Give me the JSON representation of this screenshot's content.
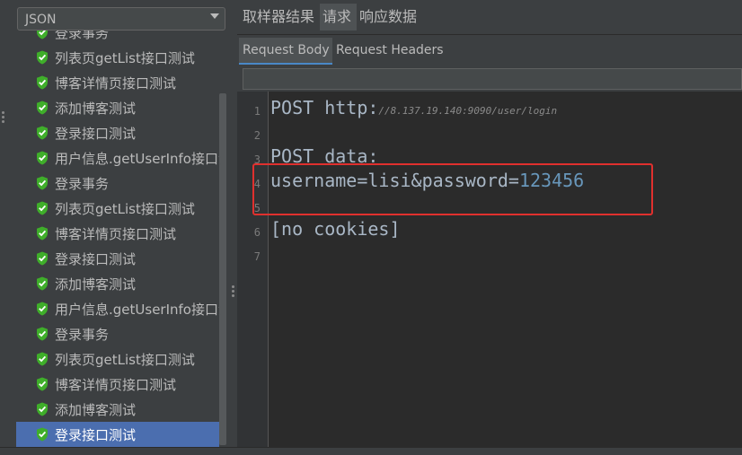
{
  "sampler_selector": {
    "value": "JSON"
  },
  "tree": {
    "items": [
      {
        "label": "登录事务",
        "selected": false
      },
      {
        "label": "列表页getList接口测试",
        "selected": false
      },
      {
        "label": "博客详情页接口测试",
        "selected": false
      },
      {
        "label": "添加博客测试",
        "selected": false
      },
      {
        "label": "登录接口测试",
        "selected": false
      },
      {
        "label": "用户信息.getUserInfo接口测",
        "selected": false
      },
      {
        "label": "登录事务",
        "selected": false
      },
      {
        "label": "列表页getList接口测试",
        "selected": false
      },
      {
        "label": "博客详情页接口测试",
        "selected": false
      },
      {
        "label": "登录接口测试",
        "selected": false
      },
      {
        "label": "添加博客测试",
        "selected": false
      },
      {
        "label": "用户信息.getUserInfo接口测",
        "selected": false
      },
      {
        "label": "登录事务",
        "selected": false
      },
      {
        "label": "列表页getList接口测试",
        "selected": false
      },
      {
        "label": "博客详情页接口测试",
        "selected": false
      },
      {
        "label": "添加博客测试",
        "selected": false
      },
      {
        "label": "登录接口测试",
        "selected": true
      }
    ]
  },
  "result_tabs": [
    "取样器结果",
    "请求",
    "响应数据"
  ],
  "request_tabs": [
    "Request Body",
    "Request Headers"
  ],
  "editor": {
    "line_numbers": [
      "1",
      "2",
      "3",
      "4",
      "5",
      "6",
      "7"
    ],
    "line1_method": "POST http:",
    "line1_url": "//8.137.19.140:9090/user/login",
    "line3": "POST data:",
    "line4_params": "username=lisi&password=",
    "line4_value": "123456",
    "line6": "[no cookies]"
  },
  "colors": {
    "selection": "#4b6eaf",
    "highlight_box": "#e0302e",
    "success_shield": "#3fae2a"
  }
}
